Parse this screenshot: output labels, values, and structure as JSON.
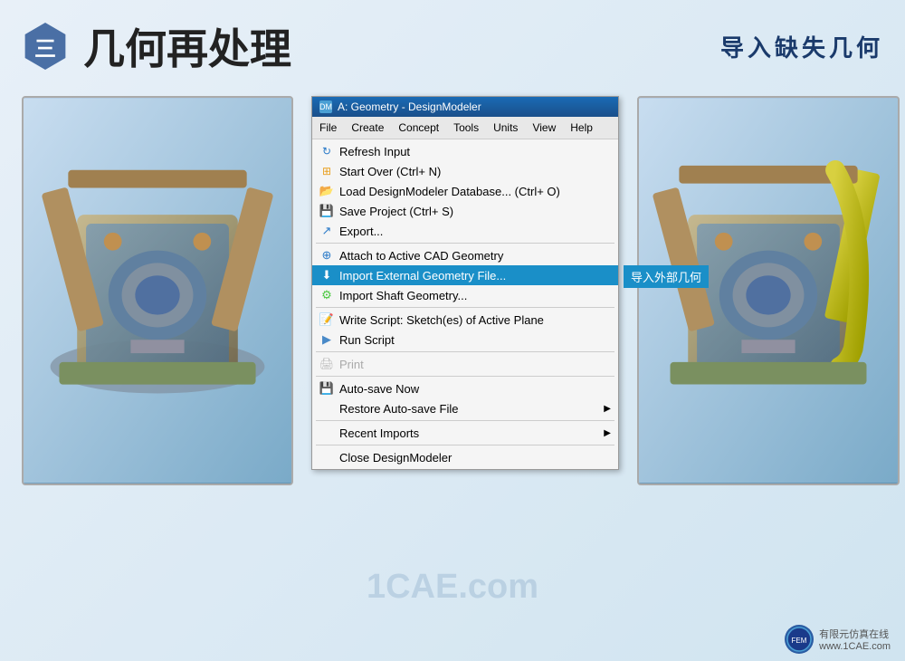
{
  "header": {
    "badge_text": "三",
    "title": "几何再处理",
    "subtitle": "导入缺失几何"
  },
  "menuWindow": {
    "titlebar": "A: Geometry - DesignModeler",
    "menubar": [
      "File",
      "Create",
      "Concept",
      "Tools",
      "Units",
      "View",
      "Help"
    ],
    "items": [
      {
        "id": "refresh",
        "icon": "↻",
        "label": "Refresh Input",
        "disabled": false,
        "separator_before": false
      },
      {
        "id": "startover",
        "icon": "⊞",
        "label": "Start Over (Ctrl+ N)",
        "disabled": false,
        "separator_before": false
      },
      {
        "id": "load",
        "icon": "📂",
        "label": "Load DesignModeler Database... (Ctrl+ O)",
        "disabled": false,
        "separator_before": false
      },
      {
        "id": "save",
        "icon": "💾",
        "label": "Save Project (Ctrl+ S)",
        "disabled": false,
        "separator_before": false
      },
      {
        "id": "export",
        "icon": "📤",
        "label": "Export...",
        "disabled": false,
        "separator_before": false
      },
      {
        "id": "sep1",
        "separator": true
      },
      {
        "id": "attach",
        "icon": "🔗",
        "label": "Attach to Active CAD Geometry",
        "disabled": false,
        "separator_before": false
      },
      {
        "id": "import",
        "icon": "📥",
        "label": "Import External Geometry File...",
        "highlighted": true,
        "cn_label": "导入外部几何",
        "disabled": false,
        "separator_before": false
      },
      {
        "id": "shaft",
        "icon": "⚙",
        "label": "Import Shaft Geometry...",
        "disabled": false,
        "separator_before": false
      },
      {
        "id": "sep2",
        "separator": true
      },
      {
        "id": "writescript",
        "icon": "📝",
        "label": "Write Script: Sketch(es) of Active Plane",
        "disabled": false,
        "separator_before": false
      },
      {
        "id": "runscript",
        "icon": "▶",
        "label": "Run Script",
        "disabled": false,
        "separator_before": false
      },
      {
        "id": "sep3",
        "separator": true
      },
      {
        "id": "print",
        "icon": "🖨",
        "label": "Print",
        "disabled": true,
        "separator_before": false
      },
      {
        "id": "sep4",
        "separator": true
      },
      {
        "id": "autosave",
        "icon": "💾",
        "label": "Auto-save Now",
        "disabled": false,
        "separator_before": false
      },
      {
        "id": "restore",
        "icon": "",
        "label": "Restore Auto-save File",
        "has_arrow": true,
        "disabled": false,
        "separator_before": false
      },
      {
        "id": "sep5",
        "separator": true
      },
      {
        "id": "recentimports",
        "icon": "",
        "label": "Recent Imports",
        "has_arrow": true,
        "disabled": false,
        "separator_before": false
      },
      {
        "id": "sep6",
        "separator": true
      },
      {
        "id": "close",
        "icon": "",
        "label": "Close DesignModeler",
        "disabled": false,
        "separator_before": false
      }
    ]
  },
  "footer": {
    "logo_text": "有限元仿真在线",
    "url": "www.1CAE.com"
  },
  "watermark": "1CAE.com"
}
